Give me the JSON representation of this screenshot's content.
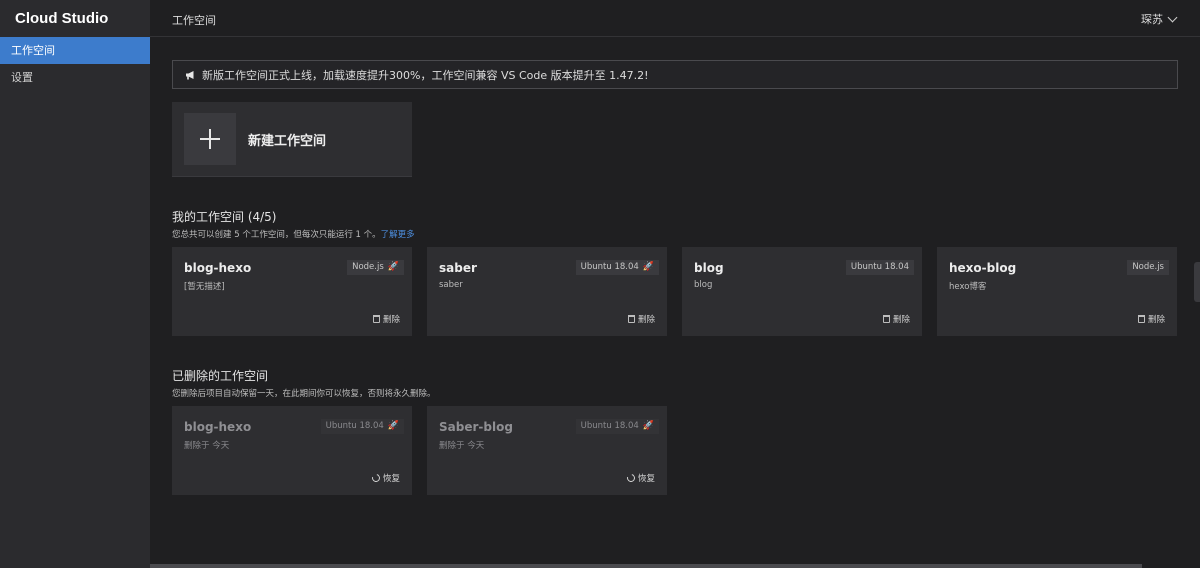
{
  "app": {
    "logo": "Cloud Studio"
  },
  "sidebar": {
    "items": [
      {
        "label": "工作空间",
        "active": true
      },
      {
        "label": "设置",
        "active": false
      }
    ]
  },
  "header": {
    "title": "工作空间",
    "user": "琛苏"
  },
  "notice": {
    "text": "新版工作空间正式上线，加载速度提升300%，工作空间兼容 VS Code 版本提升至 1.47.2!"
  },
  "new_workspace": {
    "label": "新建工作空间"
  },
  "my_workspaces": {
    "title": "我的工作空间 (4/5)",
    "subtitle": "您总共可以创建 5 个工作空间，但每次只能运行 1 个。",
    "learn_more": "了解更多",
    "cards": [
      {
        "name": "blog-hexo",
        "desc": "[暂无描述]",
        "tag": "Node.js",
        "running": true,
        "action": "删除"
      },
      {
        "name": "saber",
        "desc": "saber",
        "tag": "Ubuntu 18.04",
        "running": true,
        "action": "删除"
      },
      {
        "name": "blog",
        "desc": "blog",
        "tag": "Ubuntu 18.04",
        "running": false,
        "action": "删除"
      },
      {
        "name": "hexo-blog",
        "desc": "hexo博客",
        "tag": "Node.js",
        "running": false,
        "action": "删除"
      }
    ]
  },
  "deleted_workspaces": {
    "title": "已删除的工作空间",
    "subtitle": "您删除后项目自动保留一天，在此期间你可以恢复，否则将永久删除。",
    "cards": [
      {
        "name": "blog-hexo",
        "desc": "删除于 今天",
        "tag": "Ubuntu 18.04",
        "action": "恢复"
      },
      {
        "name": "Saber-blog",
        "desc": "删除于 今天",
        "tag": "Ubuntu 18.04",
        "action": "恢复"
      }
    ]
  },
  "colors": {
    "accent": "#3d7ccc",
    "link": "#4d8fe0",
    "rocket": "#e0504a",
    "background": "#1f1f21",
    "card": "#2e2e31"
  }
}
